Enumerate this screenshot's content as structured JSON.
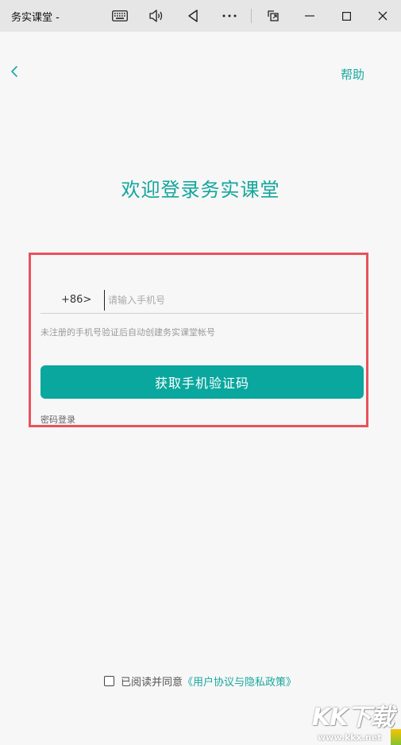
{
  "window": {
    "title": "务实课堂 -",
    "controls": [
      "keyboard-icon",
      "volume-icon",
      "back-triangle-icon",
      "more-icon",
      "snap-icon",
      "minimize-icon",
      "maximize-icon",
      "close-icon"
    ]
  },
  "header": {
    "help_label": "帮助"
  },
  "welcome_title": "欢迎登录务实课堂",
  "login": {
    "country_code": "+86>",
    "phone_placeholder": "请输入手机号",
    "phone_value": "",
    "hint": "未注册的手机号验证后自动创建务实课堂帐号",
    "get_code_button": "获取手机验证码",
    "password_login": "密码登录"
  },
  "agreement": {
    "checked": false,
    "text": "已阅读并同意",
    "policy_link": "《用户协议与隐私政策》"
  },
  "watermark": {
    "logo": "KK下载",
    "url": "www.kkx.net"
  },
  "colors": {
    "accent": "#0aa79e",
    "highlight_border": "#e8525a",
    "titlebar": "#e6e6e6",
    "background": "#f7f7f7"
  }
}
